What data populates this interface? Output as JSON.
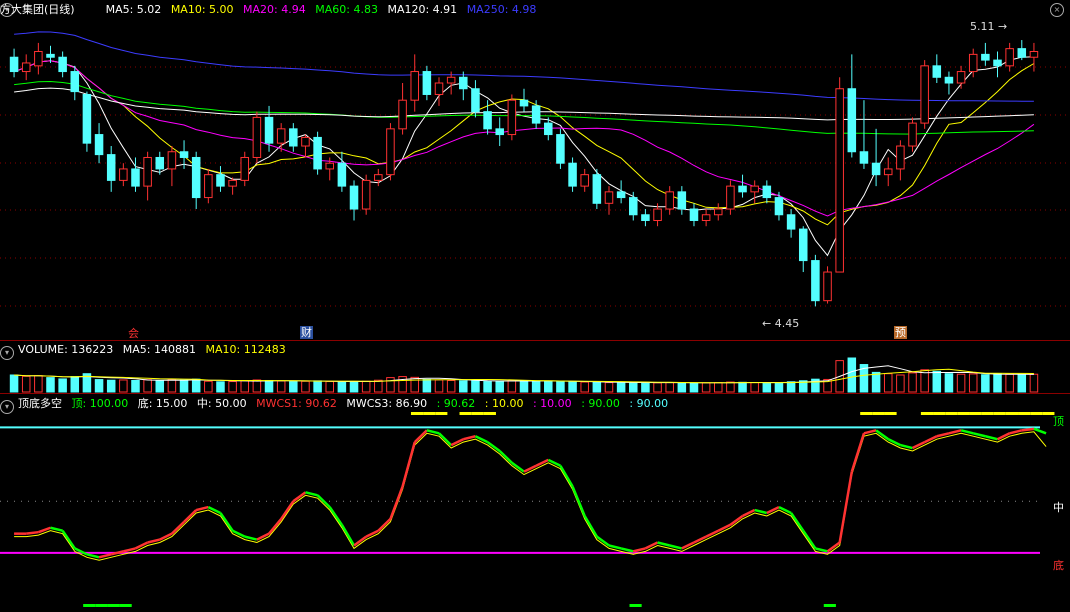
{
  "main_header": {
    "stock_title": "方大集团(日线)",
    "ma5": "MA5: 5.02",
    "ma10": "MA10: 5.00",
    "ma20": "MA20: 4.94",
    "ma60": "MA60: 4.83",
    "ma120": "MA120: 4.91",
    "ma250": "MA250: 4.98"
  },
  "volume_header": {
    "volume": "VOLUME: 136223",
    "ma5": "MA5: 140881",
    "ma10": "MA10: 112483"
  },
  "indicator_header": {
    "name": "顶底多空",
    "top": "顶: 100.00",
    "bottom": "底: 15.00",
    "mid": "中: 50.00",
    "mwcs1": "MWCS1: 90.62",
    "mwcs3": "MWCS3: 86.90",
    "v1": ": 90.62",
    "v2": ": 10.00",
    "v3": ": 10.00",
    "v4": ": 90.00",
    "v5": ": 90.00"
  },
  "annotations": {
    "high": "5.11",
    "low": "4.45",
    "event1": "会",
    "event2": "财",
    "event3": "预"
  },
  "indicator_labels": {
    "top": "顶",
    "mid": "中",
    "bottom": "底"
  },
  "colors": {
    "bg": "#000000",
    "up": "#ff3232",
    "down": "#54ffff",
    "ma5": "#ffffff",
    "ma10": "#ffff00",
    "ma20": "#ff00ff",
    "ma60": "#00ff00",
    "ma120": "#ffffff",
    "ma250": "#3c3cff",
    "grid": "#8b0000"
  },
  "chart_data": [
    {
      "type": "candlestick",
      "title": "方大集团(日线)",
      "ohlc": [
        [
          5.05,
          5.08,
          4.98,
          5.0
        ],
        [
          5.0,
          5.06,
          4.97,
          5.03
        ],
        [
          5.02,
          5.1,
          4.99,
          5.07
        ],
        [
          5.06,
          5.09,
          5.03,
          5.05
        ],
        [
          5.05,
          5.07,
          4.98,
          5.0
        ],
        [
          5.0,
          5.02,
          4.9,
          4.93
        ],
        [
          4.92,
          4.93,
          4.72,
          4.75
        ],
        [
          4.78,
          4.82,
          4.68,
          4.71
        ],
        [
          4.71,
          4.74,
          4.58,
          4.62
        ],
        [
          4.62,
          4.68,
          4.6,
          4.66
        ],
        [
          4.66,
          4.7,
          4.58,
          4.6
        ],
        [
          4.6,
          4.72,
          4.55,
          4.7
        ],
        [
          4.7,
          4.72,
          4.64,
          4.66
        ],
        [
          4.66,
          4.74,
          4.6,
          4.72
        ],
        [
          4.72,
          4.76,
          4.66,
          4.7
        ],
        [
          4.7,
          4.72,
          4.52,
          4.56
        ],
        [
          4.56,
          4.66,
          4.54,
          4.64
        ],
        [
          4.64,
          4.67,
          4.58,
          4.6
        ],
        [
          4.6,
          4.63,
          4.57,
          4.62
        ],
        [
          4.62,
          4.72,
          4.6,
          4.7
        ],
        [
          4.7,
          4.86,
          4.68,
          4.84
        ],
        [
          4.84,
          4.88,
          4.72,
          4.75
        ],
        [
          4.75,
          4.82,
          4.72,
          4.8
        ],
        [
          4.8,
          4.82,
          4.72,
          4.74
        ],
        [
          4.74,
          4.78,
          4.7,
          4.77
        ],
        [
          4.77,
          4.79,
          4.64,
          4.66
        ],
        [
          4.66,
          4.7,
          4.62,
          4.68
        ],
        [
          4.68,
          4.72,
          4.58,
          4.6
        ],
        [
          4.6,
          4.62,
          4.48,
          4.52
        ],
        [
          4.52,
          4.64,
          4.5,
          4.62
        ],
        [
          4.62,
          4.66,
          4.6,
          4.64
        ],
        [
          4.64,
          4.82,
          4.62,
          4.8
        ],
        [
          4.8,
          4.96,
          4.78,
          4.9
        ],
        [
          4.9,
          5.06,
          4.86,
          5.0
        ],
        [
          5.0,
          5.02,
          4.9,
          4.92
        ],
        [
          4.92,
          4.98,
          4.88,
          4.96
        ],
        [
          4.96,
          5.0,
          4.92,
          4.98
        ],
        [
          4.98,
          5.0,
          4.9,
          4.94
        ],
        [
          4.94,
          4.97,
          4.84,
          4.86
        ],
        [
          4.86,
          4.9,
          4.78,
          4.8
        ],
        [
          4.8,
          4.84,
          4.74,
          4.78
        ],
        [
          4.78,
          4.92,
          4.76,
          4.9
        ],
        [
          4.9,
          4.94,
          4.86,
          4.88
        ],
        [
          4.88,
          4.9,
          4.8,
          4.82
        ],
        [
          4.82,
          4.84,
          4.76,
          4.78
        ],
        [
          4.78,
          4.8,
          4.66,
          4.68
        ],
        [
          4.68,
          4.7,
          4.58,
          4.6
        ],
        [
          4.6,
          4.66,
          4.58,
          4.64
        ],
        [
          4.64,
          4.66,
          4.52,
          4.54
        ],
        [
          4.54,
          4.6,
          4.5,
          4.58
        ],
        [
          4.58,
          4.62,
          4.54,
          4.56
        ],
        [
          4.56,
          4.58,
          4.48,
          4.5
        ],
        [
          4.5,
          4.52,
          4.46,
          4.48
        ],
        [
          4.48,
          4.54,
          4.46,
          4.52
        ],
        [
          4.52,
          4.6,
          4.5,
          4.58
        ],
        [
          4.58,
          4.6,
          4.5,
          4.52
        ],
        [
          4.52,
          4.54,
          4.46,
          4.48
        ],
        [
          4.48,
          4.52,
          4.46,
          4.5
        ],
        [
          4.5,
          4.54,
          4.48,
          4.52
        ],
        [
          4.52,
          4.62,
          4.5,
          4.6
        ],
        [
          4.6,
          4.64,
          4.56,
          4.58
        ],
        [
          4.58,
          4.62,
          4.54,
          4.6
        ],
        [
          4.6,
          4.62,
          4.54,
          4.56
        ],
        [
          4.56,
          4.58,
          4.48,
          4.5
        ],
        [
          4.5,
          4.52,
          4.42,
          4.45
        ],
        [
          4.45,
          4.46,
          4.3,
          4.34
        ],
        [
          4.34,
          4.36,
          4.18,
          4.2
        ],
        [
          4.2,
          4.32,
          4.19,
          4.3
        ],
        [
          4.3,
          4.98,
          4.3,
          4.94
        ],
        [
          4.94,
          5.06,
          4.7,
          4.72
        ],
        [
          4.72,
          4.9,
          4.66,
          4.68
        ],
        [
          4.68,
          4.8,
          4.6,
          4.64
        ],
        [
          4.64,
          4.7,
          4.6,
          4.66
        ],
        [
          4.66,
          4.76,
          4.62,
          4.74
        ],
        [
          4.74,
          4.84,
          4.72,
          4.82
        ],
        [
          4.82,
          5.04,
          4.8,
          5.02
        ],
        [
          5.02,
          5.06,
          4.96,
          4.98
        ],
        [
          4.98,
          5.0,
          4.92,
          4.96
        ],
        [
          4.96,
          5.02,
          4.94,
          5.0
        ],
        [
          5.0,
          5.08,
          4.98,
          5.06
        ],
        [
          5.06,
          5.1,
          5.02,
          5.04
        ],
        [
          5.04,
          5.07,
          4.98,
          5.02
        ],
        [
          5.02,
          5.1,
          5.0,
          5.08
        ],
        [
          5.08,
          5.11,
          5.04,
          5.05
        ],
        [
          5.05,
          5.1,
          5.0,
          5.07
        ]
      ],
      "ma_series": [
        {
          "name": "MA5",
          "value": 5.02
        },
        {
          "name": "MA10",
          "value": 5.0
        },
        {
          "name": "MA20",
          "value": 4.94
        },
        {
          "name": "MA60",
          "value": 4.83
        },
        {
          "name": "MA120",
          "value": 4.91
        },
        {
          "name": "MA250",
          "value": 4.98
        }
      ],
      "high_mark": 5.11,
      "low_mark": 4.45,
      "ylim": [
        4.15,
        5.18
      ]
    },
    {
      "type": "bar",
      "title": "VOLUME",
      "values": [
        130,
        120,
        125,
        110,
        100,
        118,
        140,
        95,
        90,
        92,
        88,
        94,
        85,
        96,
        90,
        98,
        82,
        78,
        80,
        86,
        92,
        88,
        84,
        80,
        82,
        85,
        80,
        76,
        78,
        82,
        90,
        110,
        118,
        112,
        96,
        92,
        88,
        86,
        84,
        80,
        82,
        90,
        86,
        84,
        82,
        80,
        78,
        76,
        74,
        72,
        70,
        72,
        74,
        70,
        72,
        70,
        68,
        70,
        72,
        76,
        74,
        72,
        70,
        72,
        78,
        86,
        98,
        96,
        240,
        260,
        210,
        150,
        140,
        130,
        146,
        170,
        158,
        140,
        136,
        138,
        132,
        140,
        136,
        130,
        136
      ],
      "ma5": 140881,
      "ma10": 112483,
      "volume": 136223
    },
    {
      "type": "line",
      "title": "顶底多空",
      "levels": {
        "top": 100,
        "bottom": 15,
        "mid": 50
      },
      "series": [
        {
          "name": "MWCS1",
          "values": [
            28,
            28,
            29,
            32,
            30,
            18,
            14,
            12,
            14,
            16,
            18,
            22,
            24,
            28,
            36,
            44,
            46,
            42,
            30,
            26,
            24,
            28,
            38,
            50,
            56,
            54,
            46,
            34,
            20,
            26,
            30,
            38,
            60,
            90,
            98,
            96,
            88,
            92,
            94,
            90,
            84,
            76,
            70,
            74,
            78,
            74,
            60,
            40,
            26,
            20,
            18,
            16,
            18,
            22,
            20,
            18,
            22,
            26,
            30,
            34,
            40,
            44,
            42,
            46,
            42,
            30,
            18,
            16,
            22,
            70,
            96,
            98,
            92,
            88,
            86,
            90,
            94,
            96,
            98,
            96,
            94,
            92,
            96,
            98,
            99,
            96
          ]
        },
        {
          "name": "MWCS3",
          "values": [
            26,
            26,
            27,
            30,
            28,
            16,
            12,
            10,
            12,
            14,
            16,
            20,
            22,
            26,
            34,
            42,
            44,
            40,
            28,
            24,
            22,
            26,
            36,
            48,
            54,
            52,
            44,
            32,
            18,
            24,
            28,
            36,
            58,
            88,
            96,
            94,
            86,
            90,
            92,
            88,
            82,
            74,
            68,
            72,
            76,
            72,
            58,
            38,
            24,
            18,
            16,
            14,
            16,
            20,
            18,
            16,
            20,
            24,
            28,
            32,
            38,
            42,
            40,
            44,
            40,
            28,
            16,
            14,
            20,
            68,
            94,
            96,
            90,
            86,
            84,
            88,
            92,
            94,
            96,
            94,
            92,
            90,
            94,
            96,
            97,
            87
          ]
        }
      ]
    }
  ]
}
